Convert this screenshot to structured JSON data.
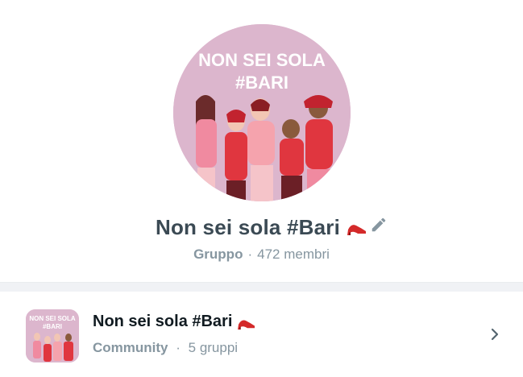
{
  "group": {
    "avatar_text_line1": "NON SEI SOLA",
    "avatar_text_line2": "#BARI",
    "name": "Non sei sola #Bari",
    "emoji_icon": "high-heel-icon",
    "type": "Gruppo",
    "separator": "·",
    "members": "472 membri"
  },
  "community": {
    "avatar_text_line1": "NON SEI SOLA",
    "avatar_text_line2": "#BARI",
    "name": "Non sei sola #Bari",
    "type": "Community",
    "separator": "·",
    "groups": "5 gruppi"
  },
  "colors": {
    "avatar_bg": "#dcb6cd",
    "accent_red": "#e0363f",
    "text_primary": "#3b4a54",
    "text_secondary": "#8696a0"
  }
}
